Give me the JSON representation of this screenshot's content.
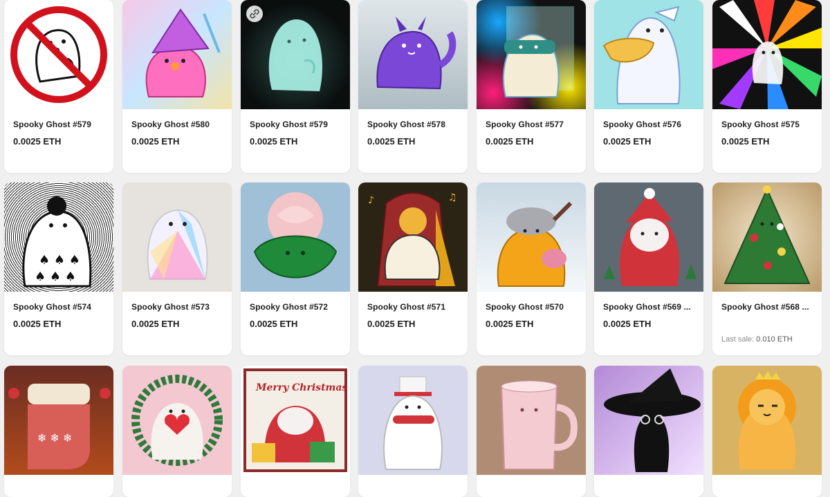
{
  "cards": [
    {
      "title": "Spooky Ghost #579",
      "price": "0.0025 ETH",
      "bg": "#ffffff",
      "icon": "prohibited-ghost"
    },
    {
      "title": "Spooky Ghost #580",
      "price": "0.0025 ETH",
      "bg": "#e9b6f0",
      "icon": "gnome-ghost-pickaxe"
    },
    {
      "title": "Spooky Ghost #579",
      "price": "0.0025 ETH",
      "bg": "#0f1514",
      "icon": "glowing-ghost",
      "link_icon": "link-icon"
    },
    {
      "title": "Spooky Ghost #578",
      "price": "0.0025 ETH",
      "bg": "#c9d3d7",
      "icon": "dragon-ghost"
    },
    {
      "title": "Spooky Ghost #577",
      "price": "0.0025 ETH",
      "bg": "#111111",
      "icon": "astronaut-ghost"
    },
    {
      "title": "Spooky Ghost #576",
      "price": "0.0025 ETH",
      "bg": "#9fe3e7",
      "icon": "pelican-ghost"
    },
    {
      "title": "Spooky Ghost #575",
      "price": "0.0025 ETH",
      "bg": "#1a1a1a",
      "icon": "rainbow-ghost"
    },
    {
      "title": "Spooky Ghost #574",
      "price": "0.0025 ETH",
      "bg": "#ffffff",
      "icon": "spade-ghost"
    },
    {
      "title": "Spooky Ghost #573",
      "price": "0.0025 ETH",
      "bg": "#e6e2dd",
      "icon": "prism-ghost"
    },
    {
      "title": "Spooky Ghost #572",
      "price": "0.0025 ETH",
      "bg": "#9fc0d6",
      "icon": "rose-ghost"
    },
    {
      "title": "Spooky Ghost #571",
      "price": "0.0025 ETH",
      "bg": "#2b2415",
      "icon": "music-ghost"
    },
    {
      "title": "Spooky Ghost #570",
      "price": "0.0025 ETH",
      "bg": "#c9d8e3",
      "icon": "winter-ghost"
    },
    {
      "title": "Spooky Ghost #569 ...",
      "price": "0.0025 ETH",
      "bg": "#5f6972",
      "icon": "knit-santa-ghost"
    },
    {
      "title": "Spooky Ghost #568 ...",
      "price": "",
      "bg": "#dcc9a8",
      "icon": "christmas-tree-ghost",
      "last_sale_label": "Last sale:",
      "last_sale_value": "0.010 ETH"
    },
    {
      "title": "",
      "price": "",
      "bg": "#7b3b2c",
      "icon": "stocking-ghost"
    },
    {
      "title": "",
      "price": "",
      "bg": "#f3c8d1",
      "icon": "wreath-heart-ghost"
    },
    {
      "title": "",
      "price": "",
      "bg": "#ffffff",
      "icon": "merry-christmas-santa-ghost",
      "banner": "Merry Christmas"
    },
    {
      "title": "",
      "price": "",
      "bg": "#d7d8ec",
      "icon": "snowman-ghost"
    },
    {
      "title": "",
      "price": "",
      "bg": "#b08c75",
      "icon": "mug-ghost"
    },
    {
      "title": "",
      "price": "",
      "bg": "#b38ad6",
      "icon": "witch-cat-ghost"
    },
    {
      "title": "",
      "price": "",
      "bg": "#d9b364",
      "icon": "lion-ghost"
    }
  ]
}
